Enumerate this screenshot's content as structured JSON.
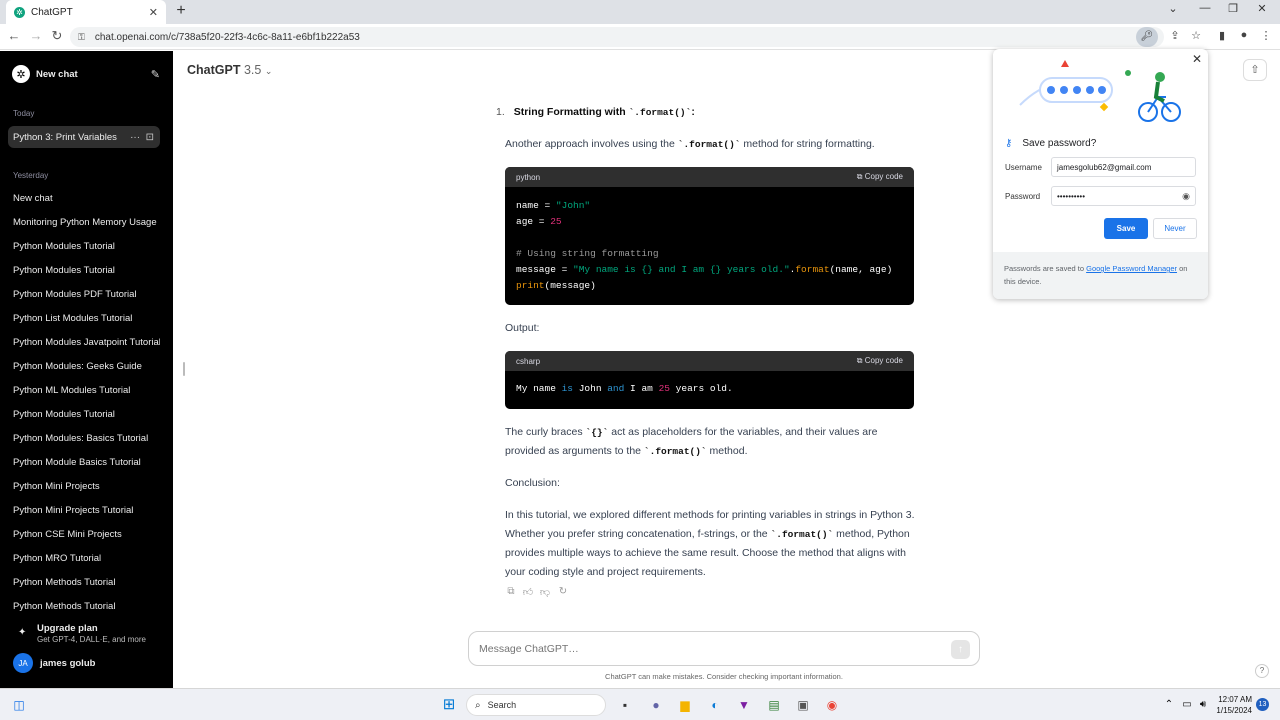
{
  "browser": {
    "tab_title": "ChatGPT",
    "new_tab": "+",
    "url": "chat.openai.com/c/738a5f20-22f3-4c6c-8a11-e6bf1b222a53"
  },
  "sidebar": {
    "new_chat": "New chat",
    "today_label": "Today",
    "active_chat": "Python 3: Print Variables",
    "yesterday_label": "Yesterday",
    "items": [
      "New chat",
      "Monitoring Python Memory Usage",
      "Python Modules Tutorial",
      "Python Modules Tutorial",
      "Python Modules PDF Tutorial",
      "Python List Modules Tutorial",
      "Python Modules Javatpoint Tutorial",
      "Python Modules: Geeks Guide",
      "Python ML Modules Tutorial",
      "Python Modules Tutorial",
      "Python Modules: Basics Tutorial",
      "Python Module Basics Tutorial",
      "Python Mini Projects",
      "Python Mini Projects Tutorial",
      "Python CSE Mini Projects",
      "Python MRO Tutorial",
      "Python Methods Tutorial",
      "Python Methods Tutorial"
    ],
    "upgrade_title": "Upgrade plan",
    "upgrade_sub": "Get GPT-4, DALL·E, and more",
    "avatar_initials": "JA",
    "user_name": "james golub"
  },
  "header": {
    "model": "ChatGPT",
    "version": "3.5"
  },
  "content": {
    "list_number": "1.",
    "heading_prefix": "String Formatting with ",
    "heading_code": "`.format()`",
    "heading_suffix": ":",
    "p1_prefix": "Another approach involves using the ",
    "p1_code": "`.format()`",
    "p1_suffix": " method for string formatting.",
    "code1_lang": "python",
    "copy_label": "Copy code",
    "output_label": "Output:",
    "code2_lang": "csharp",
    "p2_part1": "The curly braces ",
    "p2_code1": "`{}`",
    "p2_part2": " act as placeholders for the variables, and their values are provided as arguments to the ",
    "p2_code2": "`.format()`",
    "p2_part3": " method.",
    "conclusion_label": "Conclusion:",
    "p3_part1": "In this tutorial, we explored different methods for printing variables in strings in Python 3. Whether you prefer string concatenation, f-strings, or the ",
    "p3_code": "`.format()`",
    "p3_part2": " method, Python provides multiple ways to achieve the same result. Choose the method that aligns with your coding style and project requirements."
  },
  "composer": {
    "placeholder": "Message ChatGPT…",
    "disclaimer": "ChatGPT can make mistakes. Consider checking important information.",
    "help": "?"
  },
  "password_popup": {
    "title": "Save password?",
    "username_label": "Username",
    "username_value": "jamesgolub62@gmail.com",
    "password_label": "Password",
    "password_value": "••••••••••",
    "save": "Save",
    "never": "Never",
    "footer_prefix": "Passwords are saved to ",
    "footer_link": "Google Password Manager",
    "footer_suffix": " on this device."
  },
  "taskbar": {
    "search": "Search",
    "time": "12:07 AM",
    "date": "1/15/2024",
    "notifications": "13"
  }
}
